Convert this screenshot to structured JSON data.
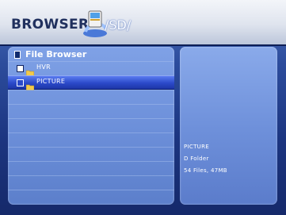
{
  "header": {
    "title": "BROWSER",
    "path": "/SD/"
  },
  "file_panel": {
    "heading": "File Browser",
    "items": [
      {
        "label": "HVR",
        "selected": false
      },
      {
        "label": "PICTURE",
        "selected": true
      }
    ]
  },
  "details": {
    "name": "PICTURE",
    "type": "D Folder",
    "summary": "54 Files, 47MB"
  },
  "colors": {
    "accent": "#2b49c9",
    "panel": "#6d90da",
    "background": "#1c3580"
  }
}
